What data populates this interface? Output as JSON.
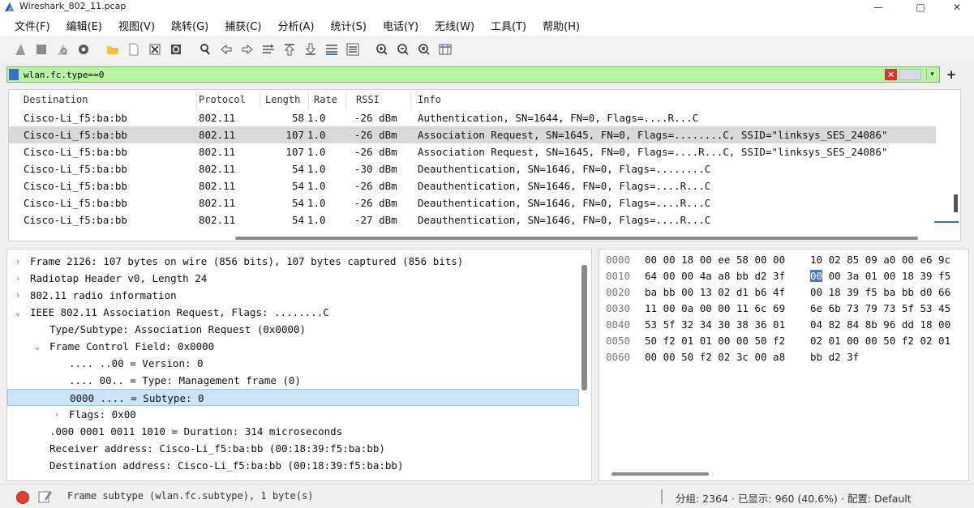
{
  "window": {
    "title": "Wireshark_802_11.pcap",
    "minimize": "—",
    "restore": "▢",
    "close": "✕"
  },
  "menu": [
    "文件(F)",
    "编辑(E)",
    "视图(V)",
    "跳转(G)",
    "捕获(C)",
    "分析(A)",
    "统计(S)",
    "电话(Y)",
    "无线(W)",
    "工具(T)",
    "帮助(H)"
  ],
  "toolbar_icons": [
    "shark-fin-start-icon",
    "stop-square-icon",
    "restart-fin-icon",
    "capture-options-gear-icon",
    "open-folder-icon",
    "save-file-icon",
    "close-file-icon",
    "reload-icon",
    "find-packet-icon",
    "go-back-icon",
    "go-forward-icon",
    "go-to-packet-icon",
    "go-first-icon",
    "go-last-icon",
    "auto-scroll-icon",
    "colorize-icon",
    "zoom-in-icon",
    "zoom-out-icon",
    "normal-size-icon",
    "resize-columns-icon"
  ],
  "filter": {
    "value": "wlan.fc.type==0"
  },
  "packet_list": {
    "columns": [
      "Destination",
      "Protocol",
      "Length",
      "Rate",
      "RSSI",
      "Info"
    ],
    "rows": [
      {
        "dst": "Cisco-Li_f5:ba:bb",
        "proto": "802.11",
        "len": "58",
        "rate": "1.0",
        "rssi": "-26 dBm",
        "info": "Authentication, SN=1644, FN=0, Flags=....R...C"
      },
      {
        "dst": "Cisco-Li_f5:ba:bb",
        "proto": "802.11",
        "len": "107",
        "rate": "1.0",
        "rssi": "-26 dBm",
        "info": "Association Request, SN=1645, FN=0, Flags=........C, SSID=\"linksys_SES_24086\""
      },
      {
        "dst": "Cisco-Li_f5:ba:bb",
        "proto": "802.11",
        "len": "107",
        "rate": "1.0",
        "rssi": "-26 dBm",
        "info": "Association Request, SN=1645, FN=0, Flags=....R...C, SSID=\"linksys_SES_24086\""
      },
      {
        "dst": "Cisco-Li_f5:ba:bb",
        "proto": "802.11",
        "len": "54",
        "rate": "1.0",
        "rssi": "-30 dBm",
        "info": "Deauthentication, SN=1646, FN=0, Flags=........C"
      },
      {
        "dst": "Cisco-Li_f5:ba:bb",
        "proto": "802.11",
        "len": "54",
        "rate": "1.0",
        "rssi": "-26 dBm",
        "info": "Deauthentication, SN=1646, FN=0, Flags=....R...C"
      },
      {
        "dst": "Cisco-Li_f5:ba:bb",
        "proto": "802.11",
        "len": "54",
        "rate": "1.0",
        "rssi": "-26 dBm",
        "info": "Deauthentication, SN=1646, FN=0, Flags=....R...C"
      },
      {
        "dst": "Cisco-Li_f5:ba:bb",
        "proto": "802.11",
        "len": "54",
        "rate": "1.0",
        "rssi": "-27 dBm",
        "info": "Deauthentication, SN=1646, FN=0, Flags=....R...C"
      }
    ],
    "selected_row": 1
  },
  "detail_tree": [
    {
      "arrow": "›",
      "text": "Frame 2126: 107 bytes on wire (856 bits), 107 bytes captured (856 bits)"
    },
    {
      "arrow": "›",
      "text": "Radiotap Header v0, Length 24"
    },
    {
      "arrow": "›",
      "text": "802.11 radio information"
    },
    {
      "arrow": "⌄",
      "text": "IEEE 802.11 Association Request, Flags: ........C"
    },
    {
      "arrow": "",
      "text": "Type/Subtype: Association Request (0x0000)"
    },
    {
      "arrow": "⌄",
      "text": "Frame Control Field: 0x0000"
    },
    {
      "arrow": "",
      "text": ".... ..00 = Version: 0"
    },
    {
      "arrow": "",
      "text": ".... 00.. = Type: Management frame (0)"
    },
    {
      "arrow": "",
      "text": "0000 .... = Subtype: 0"
    },
    {
      "arrow": "›",
      "text": "Flags: 0x00"
    },
    {
      "arrow": "",
      "text": ".000 0001 0011 1010 = Duration: 314 microseconds"
    },
    {
      "arrow": "",
      "text": "Receiver address: Cisco-Li_f5:ba:bb (00:18:39:f5:ba:bb)"
    },
    {
      "arrow": "",
      "text": "Destination address: Cisco-Li_f5:ba:bb (00:18:39:f5:ba:bb)"
    }
  ],
  "detail_selected": 8,
  "hex_dump": [
    {
      "offset": "0000",
      "a": "00 00 18 00 ee 58 00 00",
      "b": "10 02 85 09 a0 00 e6 9c"
    },
    {
      "offset": "0010",
      "a": "64 00 00 4a a8 bb d2 3f",
      "b_hl": "00",
      "b_rest": " 00 3a 01 00 18 39 f5"
    },
    {
      "offset": "0020",
      "a": "ba bb 00 13 02 d1 b6 4f",
      "b": "00 18 39 f5 ba bb d0 66"
    },
    {
      "offset": "0030",
      "a": "11 00 0a 00 00 11 6c 69",
      "b": "6e 6b 73 79 73 5f 53 45"
    },
    {
      "offset": "0040",
      "a": "53 5f 32 34 30 38 36 01",
      "b": "04 82 84 8b 96 dd 18 00"
    },
    {
      "offset": "0050",
      "a": "50 f2 01 01 00 00 50 f2",
      "b": "02 01 00 00 50 f2 02 01"
    },
    {
      "offset": "0060",
      "a": "00 00 50 f2 02 3c 00 a8",
      "b": "bb d2 3f"
    }
  ],
  "status": {
    "field_text": "Frame subtype (wlan.fc.subtype), 1 byte(s)",
    "stats": "分组: 2364 · 已显示: 960 (40.6%) · 配置: Default"
  },
  "colors": {
    "filter_bg": "#b8f5a3",
    "selected_row": "#d9d9d9",
    "detail_selected": "#cde4f8",
    "hex_highlight": "#3a78d8"
  }
}
